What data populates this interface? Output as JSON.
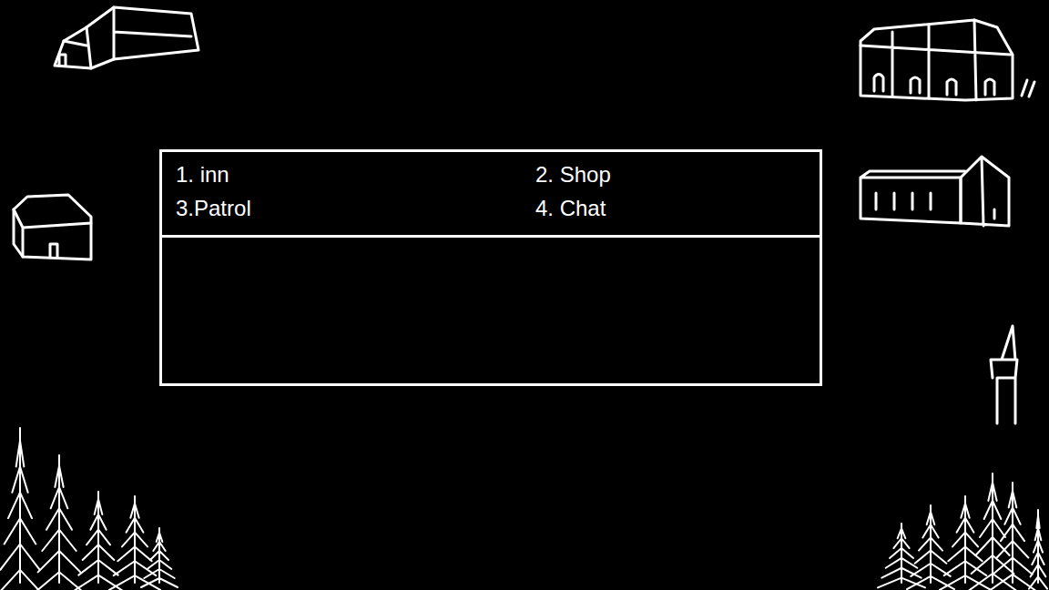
{
  "menu": {
    "options": [
      {
        "label": "1. inn"
      },
      {
        "label": "2. Shop"
      },
      {
        "label": "3.Patrol"
      },
      {
        "label": "4. Chat"
      }
    ]
  },
  "message_box": {
    "text": ""
  }
}
